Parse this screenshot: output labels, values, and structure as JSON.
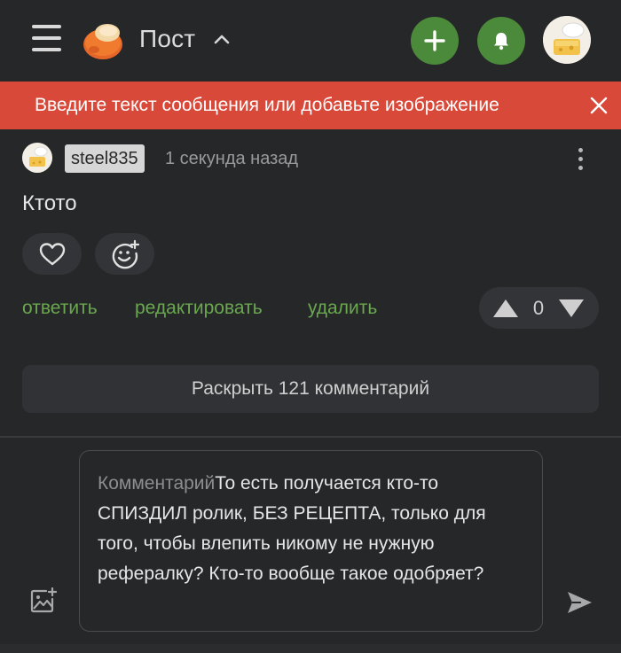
{
  "header": {
    "title": "Пост",
    "menu_icon": "hamburger-icon",
    "logo_icon": "logo-icon",
    "add_icon": "plus-icon",
    "bell_icon": "bell-icon",
    "accent_color": "#4a8a3a"
  },
  "banner": {
    "message": "Введите текст сообщения или добавьте изображение",
    "close_icon": "close-icon",
    "color": "#d9493a"
  },
  "comment": {
    "username": "steel835",
    "timestamp": "1 секунда назад",
    "text": "Ктото",
    "actions": {
      "reply": "ответить",
      "edit": "редактировать",
      "delete": "удалить"
    },
    "vote_count": "0",
    "link_color": "#6aa84f"
  },
  "expand": {
    "label": "Раскрыть 121 комментарий"
  },
  "composer": {
    "placeholder": "Комментарий",
    "value": "То есть получается кто-то СПИЗДИЛ ролик, БЕЗ РЕЦЕПТА, только для того, чтобы влепить никому не нужную рефералку? Кто-то вообще такое одобряет?"
  }
}
